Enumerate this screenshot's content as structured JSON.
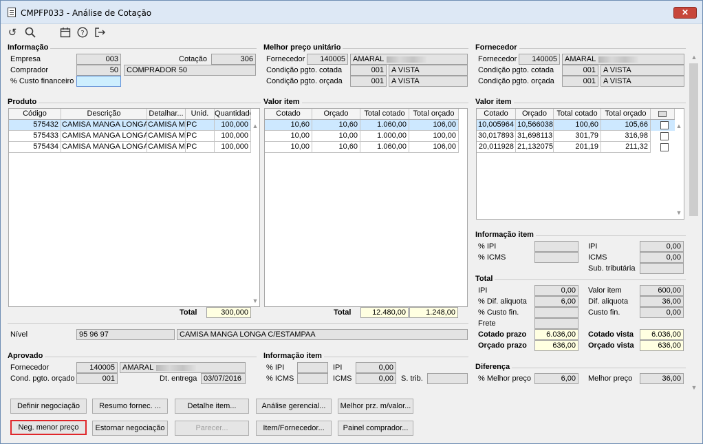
{
  "window": {
    "title": "CMPFP033 - Análise de Cotação",
    "close": "✕"
  },
  "informacao": {
    "title": "Informação",
    "empresa_label": "Empresa",
    "empresa": "003",
    "cotacao_label": "Cotação",
    "cotacao": "306",
    "comprador_label": "Comprador",
    "comprador_cod": "50",
    "comprador_nome": "COMPRADOR 50",
    "custo_label": "% Custo financeiro",
    "custo": ""
  },
  "melhor": {
    "title": "Melhor preço unitário",
    "fornecedor_label": "Fornecedor",
    "fornecedor_cod": "140005",
    "fornecedor_nome": "AMARAL",
    "cond_cotada_label": "Condição pgto. cotada",
    "cond_cotada_cod": "001",
    "cond_cotada": "A VISTA",
    "cond_orcada_label": "Condição pgto. orçada",
    "cond_orcada_cod": "001",
    "cond_orcada": "A VISTA"
  },
  "fornecedor": {
    "title": "Fornecedor",
    "fornecedor_label": "Fornecedor",
    "fornecedor_cod": "140005",
    "fornecedor_nome": "AMARAL",
    "cond_cotada_label": "Condição pgto. cotada",
    "cond_cotada_cod": "001",
    "cond_cotada": "A VISTA",
    "cond_orcada_label": "Condição pgto. orçada",
    "cond_orcada_cod": "001",
    "cond_orcada": "A VISTA"
  },
  "produto": {
    "title": "Produto",
    "headers": [
      "Código",
      "Descrição",
      "Detalhar...",
      "Unid.",
      "Quantidade"
    ],
    "rows": [
      [
        "575432",
        "CAMISA MANGA LONGA C/ESTAMPA",
        "",
        "PC",
        "100,000"
      ],
      [
        "575433",
        "CAMISA MANGA LONGA C/ESTAMPA",
        "",
        "PC",
        "100,000"
      ],
      [
        "575434",
        "CAMISA MANGA LONGA C/ESTAMPA",
        "",
        "PC",
        "100,000"
      ]
    ],
    "total_label": "Total",
    "total": "300,000"
  },
  "valor1": {
    "title": "Valor item",
    "headers": [
      "Cotado",
      "Orçado",
      "Total cotado",
      "Total orçado"
    ],
    "rows": [
      [
        "10,60",
        "10,60",
        "1.060,00",
        "106,00"
      ],
      [
        "10,00",
        "10,00",
        "1.000,00",
        "100,00"
      ],
      [
        "10,00",
        "10,60",
        "1.060,00",
        "106,00"
      ]
    ],
    "total_label": "Total",
    "total_cotado": "12.480,00",
    "total_orcado": "1.248,00"
  },
  "valor2": {
    "title": "Valor item",
    "headers": [
      "Cotado",
      "Orçado",
      "Total cotado",
      "Total orçado"
    ],
    "rows": [
      [
        "10,005964",
        "10,566038",
        "100,60",
        "105,66"
      ],
      [
        "30,017893",
        "31,698113",
        "301,79",
        "316,98"
      ],
      [
        "20,011928",
        "21,132075",
        "201,19",
        "211,32"
      ]
    ]
  },
  "infoitem": {
    "title": "Informação item",
    "pipi_label": "% IPI",
    "pipi": "",
    "ipi_label": "IPI",
    "ipi": "0,00",
    "picms_label": "% ICMS",
    "picms": "",
    "icms_label": "ICMS",
    "icms": "0,00",
    "subtrib_label": "Sub. tributária",
    "subtrib": ""
  },
  "total": {
    "title": "Total",
    "ipi_label": "IPI",
    "ipi": "0,00",
    "valoritem_label": "Valor item",
    "valoritem": "600,00",
    "difaliq_label": "% Dif. aliquota",
    "difaliq": "6,00",
    "difaliq2_label": "Dif. aliquota",
    "difaliq2": "36,00",
    "custofin_label": "% Custo fin.",
    "custofin": "",
    "custofin2_label": "Custo fin.",
    "custofin2": "0,00",
    "frete_label": "Frete",
    "frete": "",
    "cotprazo_label": "Cotado prazo",
    "cotprazo": "6.036,00",
    "cotvista_label": "Cotado vista",
    "cotvista": "6.036,00",
    "orcprazo_label": "Orçado prazo",
    "orcprazo": "636,00",
    "orcvista_label": "Orçado vista",
    "orcvista": "636,00"
  },
  "nivel": {
    "label": "Nível",
    "codigo": "95 96 97",
    "descricao": "CAMISA MANGA LONGA C/ESTAMPAA"
  },
  "aprovado": {
    "title": "Aprovado",
    "fornecedor_label": "Fornecedor",
    "fornecedor_cod": "140005",
    "fornecedor_nome": "AMARAL",
    "cond_label": "Cond. pgto. orçado",
    "cond_cod": "001",
    "dt_label": "Dt. entrega",
    "dt": "03/07/2016"
  },
  "infoitem2": {
    "title": "Informação item",
    "pipi_label": "% IPI",
    "pipi": "",
    "ipi_label": "IPI",
    "ipi": "0,00",
    "picms_label": "% ICMS",
    "picms": "",
    "icms_label": "ICMS",
    "icms": "0,00",
    "strib_label": "S. trib.",
    "strib": ""
  },
  "diferenca": {
    "title": "Diferença",
    "pmelhor_label": "% Melhor preço",
    "pmelhor": "6,00",
    "melhor_label": "Melhor preço",
    "melhor": "36,00"
  },
  "buttons": {
    "definir": "Definir negociação",
    "resumo": "Resumo fornec. ...",
    "detalhe": "Detalhe item...",
    "analise": "Análise gerencial...",
    "melhorprz": "Melhor prz. m/valor...",
    "negmenor": "Neg. menor preço",
    "estornar": "Estornar negociação",
    "parecer": "Parecer...",
    "itemforn": "Item/Fornecedor...",
    "painel": "Painel comprador..."
  }
}
